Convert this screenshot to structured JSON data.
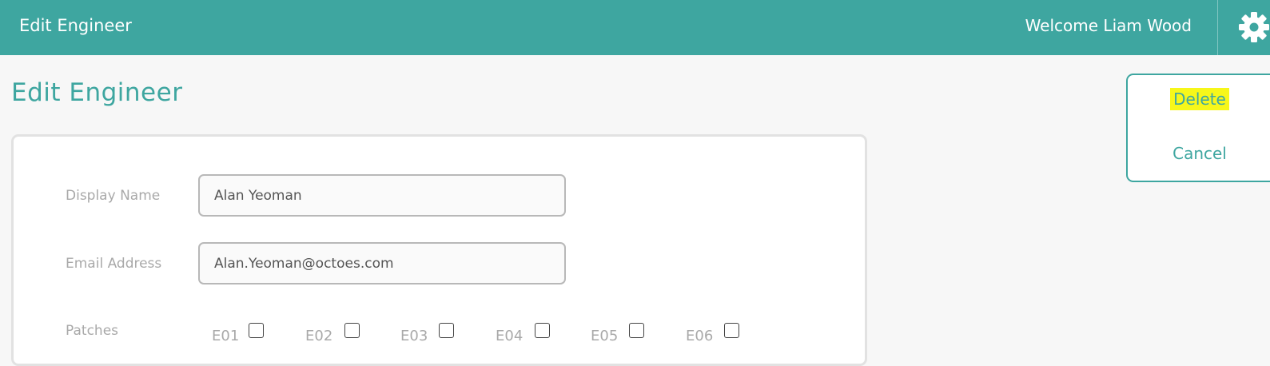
{
  "header": {
    "app_title": "Edit Engineer",
    "welcome_text": "Welcome Liam Wood",
    "settings_icon": "gear-icon"
  },
  "page": {
    "title": "Edit Engineer"
  },
  "actions": {
    "delete_label": "Delete",
    "cancel_label": "Cancel",
    "delete_highlight_color": "#f7f71a"
  },
  "form": {
    "display_name": {
      "label": "Display Name",
      "value": "Alan Yeoman"
    },
    "email": {
      "label": "Email Address",
      "value": "Alan.Yeoman@octoes.com"
    },
    "patches": {
      "label": "Patches",
      "items": [
        {
          "code": "E01",
          "checked": false
        },
        {
          "code": "E02",
          "checked": false
        },
        {
          "code": "E03",
          "checked": false
        },
        {
          "code": "E04",
          "checked": false
        },
        {
          "code": "E05",
          "checked": false
        },
        {
          "code": "E06",
          "checked": false
        }
      ]
    }
  },
  "colors": {
    "accent": "#3ea6a0",
    "background": "#f7f7f7"
  }
}
